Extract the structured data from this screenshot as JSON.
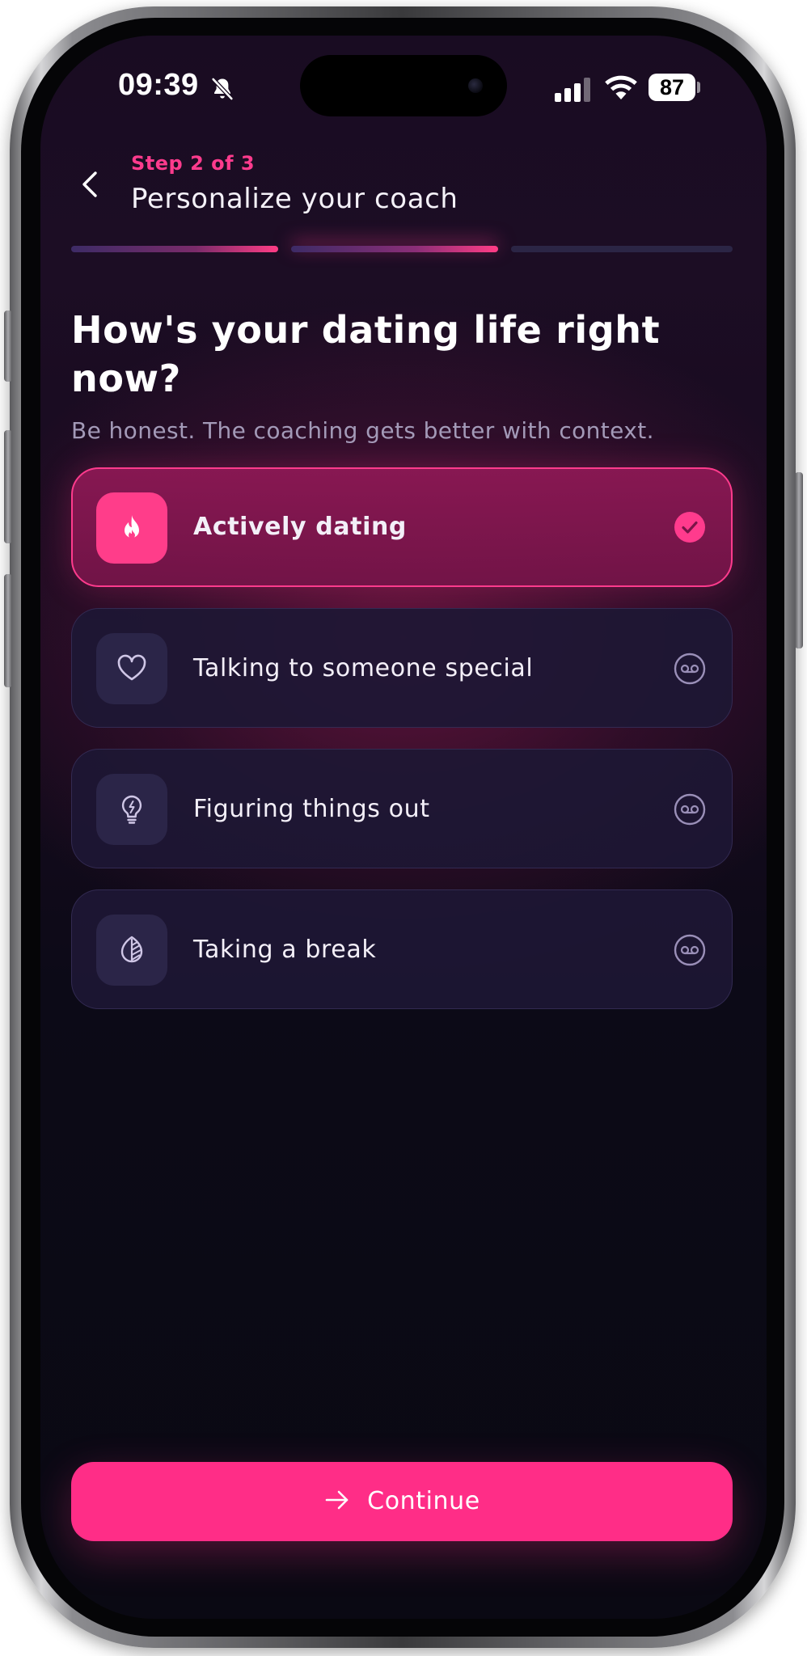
{
  "status_bar": {
    "time": "09:39",
    "battery": "87"
  },
  "header": {
    "step": "Step 2 of 3",
    "title": "Personalize your coach"
  },
  "progress": {
    "current_step": 2,
    "total_steps": 3
  },
  "question": {
    "title": "How's your dating life right now?",
    "subtitle": "Be honest. The coaching gets better with context."
  },
  "options": [
    {
      "label": "Actively dating",
      "icon": "flame-icon",
      "selected": true
    },
    {
      "label": "Talking to someone special",
      "icon": "heart-icon",
      "selected": false
    },
    {
      "label": "Figuring things out",
      "icon": "lightbulb-icon",
      "selected": false
    },
    {
      "label": "Taking a break",
      "icon": "leaf-icon",
      "selected": false
    }
  ],
  "continue_button": {
    "label": "Continue",
    "icon": "arrow-right-icon"
  },
  "colors": {
    "accent": "#ff2d87",
    "selected_card": "#8c1854",
    "card": "#1d1734",
    "background": "#0a0913",
    "subtitle_text": "#a39ab8"
  }
}
